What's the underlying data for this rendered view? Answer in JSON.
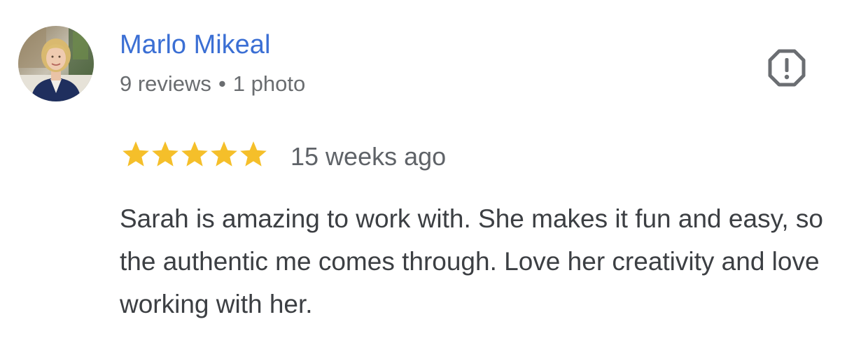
{
  "reviewer": {
    "name": "Marlo Mikeal",
    "reviews_count": "9 reviews",
    "separator": "•",
    "photos_count": "1 photo",
    "avatar": "profile-photo"
  },
  "review": {
    "rating": 5,
    "rating_max": 5,
    "date": "15 weeks ago",
    "text": "Sarah is amazing to work with. She makes it fun and easy, so the authentic me comes through. Love her creativity and love working with her."
  },
  "actions": {
    "flag_icon": "report-flag-icon"
  },
  "colors": {
    "name_link": "#3b6fd4",
    "star": "#f5bf2a",
    "meta_text": "#6a6d70",
    "body_text": "#3c3f43",
    "icon": "#6b6e72"
  }
}
